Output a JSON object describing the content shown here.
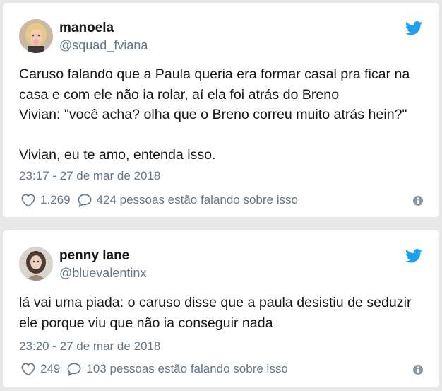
{
  "tweets": [
    {
      "display_name": "manoela",
      "username": "@squad_fviana",
      "avatar_icon": "avatar-photo-woman-blonde",
      "text_lines": [
        "Caruso falando que a Paula queria era formar casal pra ficar na",
        "casa e com ele não ia rolar, aí ela foi atrás do Breno",
        "Vivian: \"você acha? olha que o Breno correu muito atrás hein?\"",
        "",
        "Vivian, eu te amo, entenda isso."
      ],
      "timestamp": "23:17 - 27 de mar de 2018",
      "likes": "1.269",
      "replies_text": "424 pessoas estão falando sobre isso"
    },
    {
      "display_name": "penny lane",
      "username": "@bluevalentinx",
      "avatar_icon": "avatar-photo-woman-dark-hair",
      "text_lines": [
        "lá vai uma piada: o caruso disse que a paula desistiu de seduzir",
        "ele porque viu que não ia conseguir nada"
      ],
      "timestamp": "23:20 - 27 de mar de 2018",
      "likes": "249",
      "replies_text": "103 pessoas estão falando sobre isso"
    }
  ],
  "colors": {
    "twitter_blue": "#1da1f2",
    "text_primary": "#14171a",
    "text_secondary": "#657786",
    "border": "#e1e8ed"
  },
  "icons": [
    "twitter-bird-icon",
    "heart-icon",
    "comment-bubble-icon",
    "info-icon"
  ]
}
